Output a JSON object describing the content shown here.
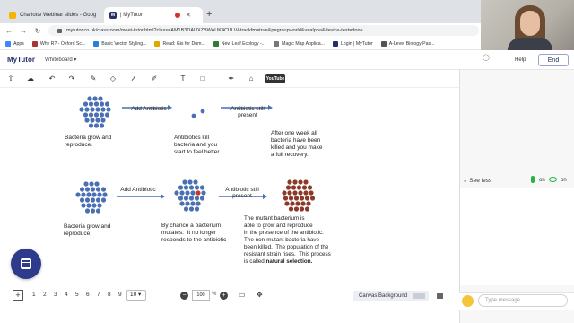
{
  "browser": {
    "tabs": [
      {
        "label": "Charlotte Webinar slides - Goog"
      },
      {
        "label": "| MyTutor",
        "favicon_text": "M"
      }
    ],
    "url": "mytutor.co.uk/classroom/meet-tutor.html?class=AM1B3DAUXZBWAUK4CULV&trackfm=true&p=groupworld&v=alpha&device-test=done",
    "bookmarks": [
      {
        "label": "Apps",
        "color": "#4285f4"
      },
      {
        "label": "Why R? - Oxford Sc...",
        "color": "#a33"
      },
      {
        "label": "Basic Vector Styling...",
        "color": "#2a7de1"
      },
      {
        "label": "Read: Gis for Dum...",
        "color": "#e0a800"
      },
      {
        "label": "New Leaf Ecology -...",
        "color": "#2e7d32"
      },
      {
        "label": "Magic Map Applica...",
        "color": "#777777"
      },
      {
        "label": "Login | MyTutor",
        "color": "#25306b"
      },
      {
        "label": "A-Level Biology Pas...",
        "color": "#555555"
      }
    ]
  },
  "app": {
    "logo": "MyTutor",
    "whiteboard_menu": "Whiteboard ▾",
    "help": "Help",
    "end": "End"
  },
  "toolbar": {
    "youtube_label": "YouTube",
    "tools": [
      "upload-icon",
      "cloud-icon",
      "undo-icon",
      "redo-icon",
      "eraser-icon",
      "pointer-icon",
      "pen-icon",
      "text-icon",
      "shape-icon",
      "highlighter-icon",
      "fill-icon",
      "stamp-icon"
    ]
  },
  "diagram": {
    "row1": {
      "arrow1": "Add\nAntibiotic",
      "arrow2": "Antibiotic\nstill present",
      "caption1": "Bacteria grow and\nreproduce.",
      "caption2": "Antibiotics kill\nbacteria and you\nstart to feel better.",
      "caption3": "After one week all\nbacteria have been\nkilled and you make\na full recovery."
    },
    "row2": {
      "arrow1": "Add\nAntibiotic",
      "arrow2": "Antibiotic\nstill present",
      "caption1": "Bacteria grow and\nreproduce.",
      "caption2": "By chance a bacterium\nmutates.  It no longer\nresponds to the antibiotic",
      "caption3": "The mutant bacterium is\nable to grow and reproduce\nin the presence of the antibiotic.\nThe non-mutant bacteria have\nbeen killed.  The population of the\nresistant strain rises.  This process\nis called ",
      "caption3_bold": "natural selection."
    },
    "colors": {
      "bacteria": "#4a6fb3",
      "mutant": "#c0392b",
      "resistant": "#8b3a2a",
      "arrow": "#4a6fb3"
    }
  },
  "bottom": {
    "add_page": "+",
    "pages": [
      "1",
      "2",
      "3",
      "4",
      "5",
      "6",
      "7",
      "8",
      "9"
    ],
    "page_select": "10 ▾",
    "zoom_out": "−",
    "zoom_value": "100",
    "zoom_unit": "%",
    "zoom_in": "+",
    "canvas_background": "Canvas Background"
  },
  "panel": {
    "see_less": "⌄  See less",
    "mic_on": "on",
    "cam_on": "on",
    "message_placeholder": "Type message"
  }
}
